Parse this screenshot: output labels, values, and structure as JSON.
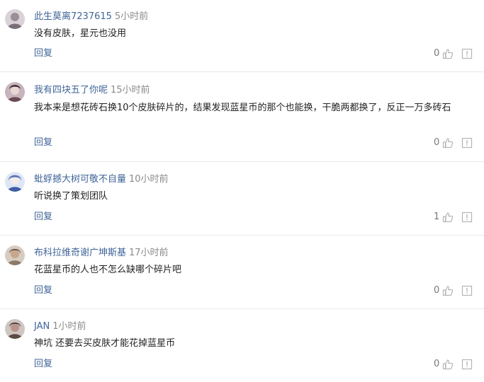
{
  "comments": [
    {
      "user": "此生莫离7237615",
      "time": "5小时前",
      "text": "没有皮肤，星元也没用",
      "reply": "回复",
      "likes": "0",
      "avatar_color": "#9a8f98"
    },
    {
      "user": "我有四块五了你呢",
      "time": "15小时前",
      "text": "我本来是想花砖石换10个皮肤碎片的，结果发现蓝星币的那个也能换，干脆两都换了，反正一万多砖石",
      "reply": "回复",
      "likes": "0",
      "avatar_color": "#6b4a58"
    },
    {
      "user": "蚍蜉撼大树可敬不自量",
      "time": "10小时前",
      "text": "听说换了策划团队",
      "reply": "回复",
      "likes": "1",
      "avatar_color": "#5a76b8"
    },
    {
      "user": "布科拉维奇谢广坤斯基",
      "time": "17小时前",
      "text": "花蓝星币的人也不怎么缺哪个碎片吧",
      "reply": "回复",
      "likes": "0",
      "avatar_color": "#8c7a6a"
    },
    {
      "user": "JAN",
      "time": "1小时前",
      "text": "神坑 还要去买皮肤才能花掉蓝星币",
      "reply": "回复",
      "likes": "0",
      "avatar_color": "#5c4a44"
    }
  ],
  "colors": {
    "username": "#406599",
    "time": "#8a8a8a",
    "body": "#222222",
    "icon": "#b5b5b5"
  },
  "icons": {
    "like": "thumbs-up-icon",
    "report": "report-icon"
  }
}
